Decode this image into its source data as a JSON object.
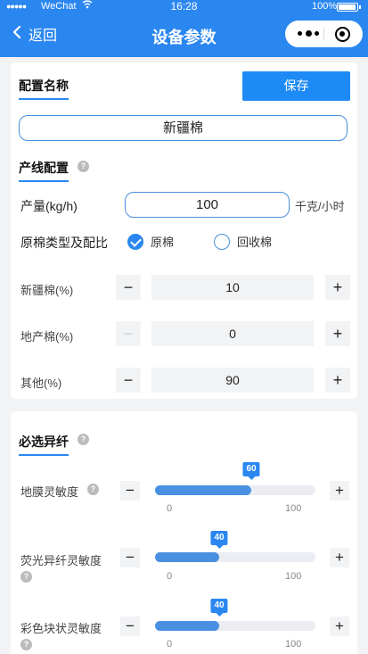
{
  "status_bar": {
    "signal": "●●●●●",
    "carrier": "WeChat",
    "time": "16:28",
    "battery": "100%"
  },
  "nav": {
    "back_label": "返回",
    "title": "设备参数"
  },
  "config": {
    "section_title": "配置名称",
    "save_label": "保存",
    "name_value": "新疆棉"
  },
  "line": {
    "section_title": "产线配置",
    "output_label": "产量(kg/h)",
    "output_value": "100",
    "output_unit": "千克/小时",
    "cotton_type_label": "原棉类型及配比",
    "radio_options": [
      {
        "label": "原棉",
        "checked": true
      },
      {
        "label": "回收棉",
        "checked": false
      }
    ],
    "ratios": [
      {
        "label": "新疆棉(%)",
        "value": "10",
        "minus_disabled": false
      },
      {
        "label": "地产棉(%)",
        "value": "0",
        "minus_disabled": true
      },
      {
        "label": "其他(%)",
        "value": "90",
        "minus_disabled": false
      }
    ],
    "minus": "−",
    "plus": "+"
  },
  "fibers": {
    "section_title": "必选异纤",
    "sliders": [
      {
        "label": "地膜灵敏度",
        "value": 60,
        "value_text": "60",
        "min": "0",
        "max": "100"
      },
      {
        "label": "荧光异纤灵敏度",
        "value": 40,
        "value_text": "40",
        "min": "0",
        "max": "100"
      },
      {
        "label": "彩色块状灵敏度",
        "value": 40,
        "value_text": "40",
        "min": "0",
        "max": "100"
      }
    ],
    "minus": "−",
    "plus": "+"
  },
  "icons": {
    "back": "chevron-left-icon",
    "help": "question-icon",
    "more": "more-dots-icon",
    "close": "close-miniprogram-icon"
  },
  "colors": {
    "primary": "#2b87f0",
    "slider_fill": "#4a90e2"
  }
}
